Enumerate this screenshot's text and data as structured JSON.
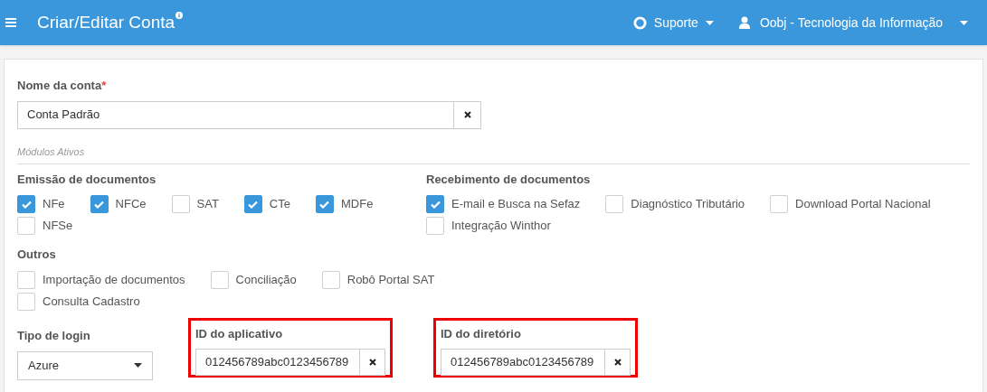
{
  "header": {
    "title": "Criar/Editar Conta",
    "support": "Suporte",
    "user": "Oobj - Tecnologia da Informação"
  },
  "account_name": {
    "label": "Nome da conta",
    "required_mark": "*",
    "value": "Conta Padrão"
  },
  "modules_caption": "Módulos Ativos",
  "groups": [
    {
      "title": "Emissão de documentos",
      "items": [
        {
          "label": "NFe",
          "checked": true
        },
        {
          "label": "NFCe",
          "checked": true
        },
        {
          "label": "SAT",
          "checked": false
        },
        {
          "label": "CTe",
          "checked": true
        },
        {
          "label": "MDFe",
          "checked": true
        },
        {
          "label": "NFSe",
          "checked": false
        }
      ]
    },
    {
      "title": "Recebimento de documentos",
      "items": [
        {
          "label": "E-mail e Busca na Sefaz",
          "checked": true
        },
        {
          "label": "Diagnóstico Tributário",
          "checked": false
        },
        {
          "label": "Download Portal Nacional",
          "checked": false
        },
        {
          "label": "Integração Winthor",
          "checked": false
        }
      ]
    },
    {
      "title": "Outros",
      "items": [
        {
          "label": "Importação de documentos",
          "checked": false
        },
        {
          "label": "Conciliação",
          "checked": false
        },
        {
          "label": "Robô Portal SAT",
          "checked": false
        },
        {
          "label": "Consulta Cadastro",
          "checked": false
        }
      ]
    }
  ],
  "login_type": {
    "label": "Tipo de login",
    "value": "Azure"
  },
  "id_fields": [
    {
      "label": "ID do aplicativo",
      "value": "012456789abc0123456789",
      "highlighted": true
    },
    {
      "label": "ID do diretório",
      "value": "012456789abc0123456789",
      "highlighted": true
    }
  ]
}
